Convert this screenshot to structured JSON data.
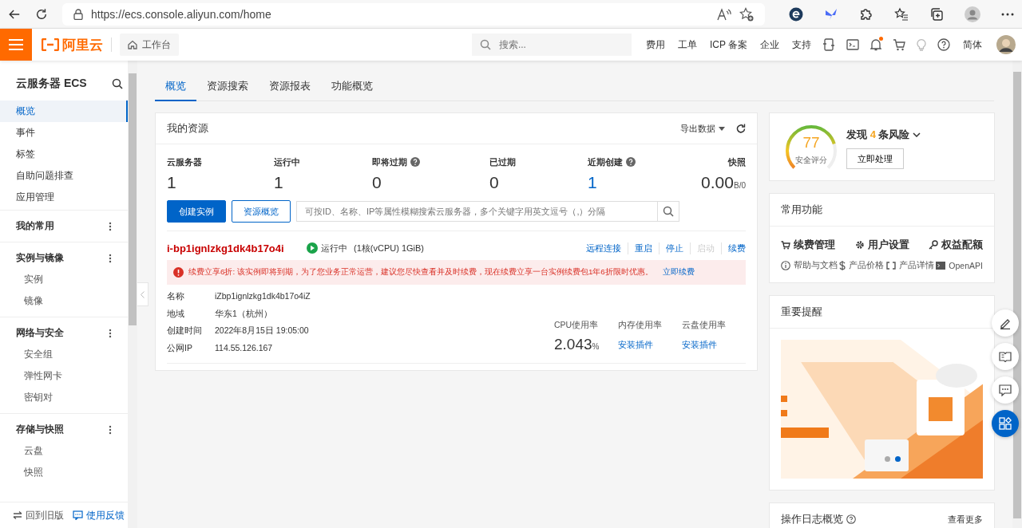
{
  "browser": {
    "url": "https://ecs.console.aliyun.com/home"
  },
  "header": {
    "logo": "阿里云",
    "home": "工作台",
    "search_placeholder": "搜索...",
    "links": [
      "费用",
      "工单",
      "ICP 备案",
      "企业",
      "支持"
    ],
    "has_unread": true,
    "language": "简体"
  },
  "sidebar": {
    "title": "云服务器 ECS",
    "items": [
      {
        "label": "概览",
        "selected": true
      },
      {
        "label": "事件",
        "selected": false
      },
      {
        "label": "标签",
        "selected": false
      },
      {
        "label": "自助问题排查",
        "selected": false
      },
      {
        "label": "应用管理",
        "selected": false
      }
    ],
    "groups": [
      {
        "title": "我的常用"
      },
      {
        "title": "实例与镜像",
        "items": [
          {
            "label": "实例",
            "selected": false
          },
          {
            "label": "镜像",
            "selected": false
          }
        ]
      },
      {
        "title": "网络与安全",
        "items": [
          {
            "label": "安全组",
            "selected": false
          },
          {
            "label": "弹性网卡",
            "selected": false
          },
          {
            "label": "密钥对",
            "selected": false
          }
        ]
      },
      {
        "title": "存储与快照",
        "items": [
          {
            "label": "云盘",
            "selected": false
          },
          {
            "label": "快照",
            "selected": false
          }
        ]
      }
    ],
    "footer": [
      "回到旧版",
      "使用反馈"
    ]
  },
  "tabs": [
    {
      "label": "概览",
      "selected": true
    },
    {
      "label": "资源搜索",
      "selected": false
    },
    {
      "label": "资源报表",
      "selected": false
    },
    {
      "label": "功能概览",
      "selected": false
    }
  ],
  "resources": {
    "title": "我的资源",
    "export": "导出数据",
    "stats": [
      {
        "label": "云服务器",
        "value": "1",
        "help": false,
        "link": false
      },
      {
        "label": "运行中",
        "value": "1",
        "help": false,
        "link": false
      },
      {
        "label": "即将过期",
        "value": "0",
        "help": true,
        "link": false
      },
      {
        "label": "已过期",
        "value": "0",
        "help": false,
        "link": false
      },
      {
        "label": "近期创建",
        "value": "1",
        "help": true,
        "link": true
      },
      {
        "label": "快照",
        "value": "0.00",
        "unit": "B/0",
        "help": false,
        "link": false
      }
    ],
    "create_button": "创建实例",
    "overview_button": "资源概览",
    "search_placeholder": "可按ID、名称、IP等属性模糊搜索云服务器，多个关键字用英文逗号（,）分隔",
    "instance": {
      "id": "i-bp1ignlzkg1dk4b17o4i",
      "status": "运行中",
      "running": true,
      "spec": "(1核(vCPU) 1GiB)",
      "actions": [
        {
          "label": "远程连接",
          "disabled": false
        },
        {
          "label": "重启",
          "disabled": false
        },
        {
          "label": "停止",
          "disabled": false
        },
        {
          "label": "启动",
          "disabled": true
        },
        {
          "label": "续费",
          "disabled": false
        }
      ],
      "alert": {
        "text": "续费立享6折: 该实例即将到期，为了您业务正常运营，建议您尽快查看并及时续费，现在续费立享一台实例续费包1年6折限时优惠。",
        "link": "立即续费"
      },
      "details": [
        {
          "label": "名称",
          "value": "iZbp1ignlzkg1dk4b17o4iZ"
        },
        {
          "label": "地域",
          "value": "华东1（杭州）"
        },
        {
          "label": "创建时间",
          "value": "2022年8月15日 19:05:00"
        },
        {
          "label": "公网IP",
          "value": "114.55.126.167"
        }
      ],
      "metrics": [
        {
          "label": "CPU使用率",
          "kind": "value",
          "value": "2.043",
          "unit": "%"
        },
        {
          "label": "内存使用率",
          "kind": "link",
          "value": "安装插件"
        },
        {
          "label": "云盘使用率",
          "kind": "link",
          "value": "安装插件"
        }
      ]
    }
  },
  "security": {
    "score": "77",
    "label": "安全评分",
    "level": 0.77,
    "risk_prefix": "发现",
    "risk_count": "4",
    "risk_suffix": "条风险",
    "button": "立即处理"
  },
  "functions": {
    "title": "常用功能",
    "primary": [
      {
        "kind": "cart",
        "label": "续费管理"
      },
      {
        "kind": "gear",
        "label": "用户设置"
      },
      {
        "kind": "key",
        "label": "权益配额"
      }
    ],
    "secondary": [
      {
        "kind": "info",
        "label": "帮助与文档"
      },
      {
        "kind": "dollar",
        "label": "产品价格"
      },
      {
        "kind": "code",
        "label": "产品详情"
      },
      {
        "kind": "terminal",
        "label": "OpenAPI"
      }
    ]
  },
  "reminder": {
    "title": "重要提醒",
    "banner": {
      "kind": "picture",
      "dots": [
        {
          "selected": false
        },
        {
          "selected": true
        }
      ]
    }
  },
  "log": {
    "title": "操作日志概览",
    "more": "查看更多"
  }
}
